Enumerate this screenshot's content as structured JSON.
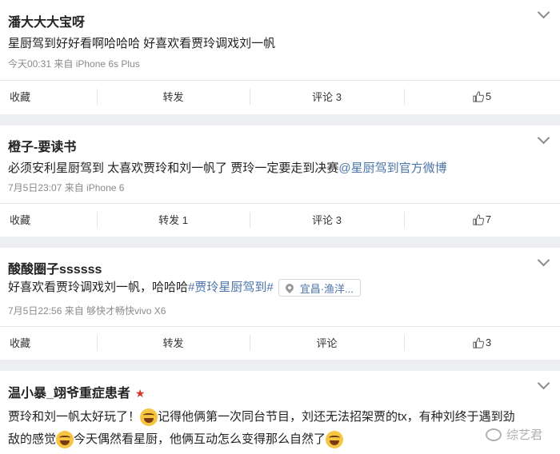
{
  "posts": [
    {
      "user": "潘大大大宝呀",
      "text": "星厨驾到好好看啊哈哈哈 好喜欢看贾玲调戏刘一帆",
      "meta": "今天00:31 来自 iPhone 6s Plus",
      "actions": {
        "collect": "收藏",
        "repost": "转发",
        "comment": "评论 3",
        "like": "5"
      }
    },
    {
      "user": "橙子-要读书",
      "text": "必须安利星厨驾到 太喜欢贾玲和刘一帆了 贾玲一定要走到决赛",
      "mention": "@星厨驾到官方微博",
      "meta": "7月5日23:07 来自 iPhone 6",
      "actions": {
        "collect": "收藏",
        "repost": "转发 1",
        "comment": "评论 3",
        "like": "7"
      }
    },
    {
      "user": "酸酸圈子ssssss",
      "text": "好喜欢看贾玲调戏刘一帆，哈哈哈",
      "hashtag": "#贾玲星厨驾到#",
      "location": "宜昌·渔洋...",
      "meta": "7月5日22:56 来自 够快才畅快vivo X6",
      "actions": {
        "collect": "收藏",
        "repost": "转发",
        "comment": "评论",
        "like": "3"
      }
    },
    {
      "user": "温小暴_翊爷重症患者",
      "line1a": "贾玲和刘一帆太好玩了！",
      "line1b": "记得他俩第一次同台节目，刘还无法招架贾的tx，有种刘终于遇到劲",
      "line2a": "敌的感觉",
      "line2b": "今天偶然看星厨，他俩互动怎么变得那么自然了"
    }
  ],
  "watermark": "综艺君",
  "icons": {
    "more": "chevron-down-icon",
    "like": "thumbs-up-icon",
    "location": "location-pin-icon",
    "emoji": "laughing-tears-emoji",
    "vip": "star-icon"
  },
  "colors": {
    "link": "#4b74a8",
    "bg": "#eceef1",
    "meta": "#8a8a8a"
  }
}
